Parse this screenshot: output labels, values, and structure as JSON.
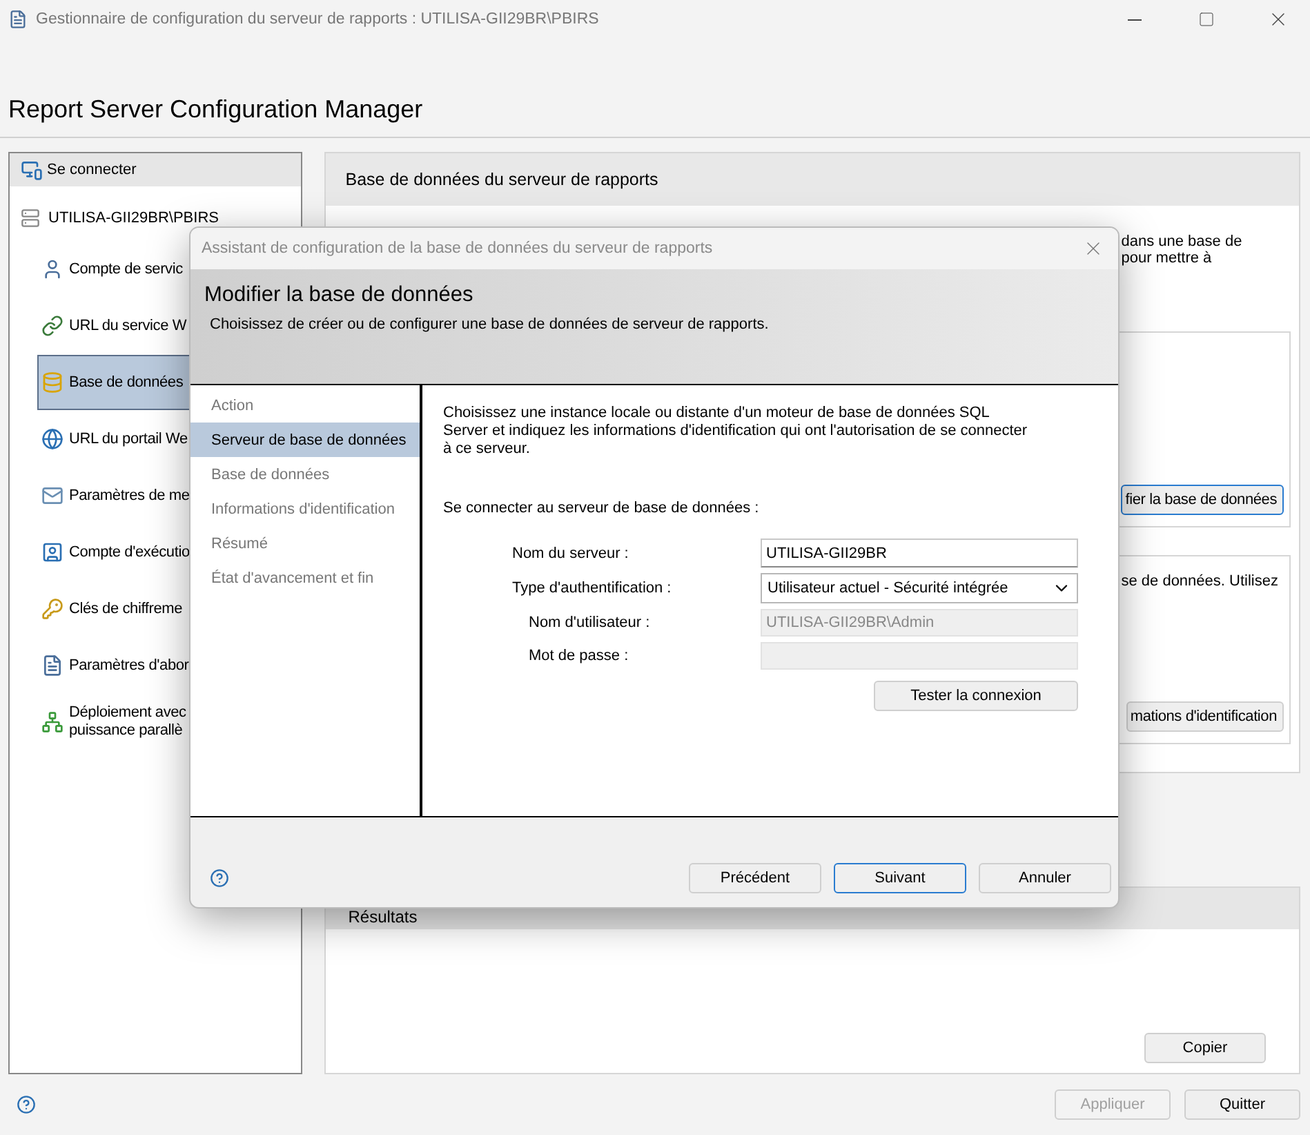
{
  "window": {
    "title": "Gestionnaire de configuration du serveur de rapports : UTILISA-GII29BR\\PBIRS"
  },
  "app_title": "Report Server Configuration Manager",
  "sidebar": {
    "connect": "Se connecter",
    "server": "UTILISA-GII29BR\\PBIRS",
    "items": [
      {
        "lines": [
          "Compte de servic"
        ],
        "selected": false
      },
      {
        "lines": [
          "URL du service W"
        ],
        "selected": false
      },
      {
        "lines": [
          "Base de données"
        ],
        "selected": true
      },
      {
        "lines": [
          "URL du portail We"
        ],
        "selected": false
      },
      {
        "lines": [
          "Paramètres de me"
        ],
        "selected": false
      },
      {
        "lines": [
          "Compte d'exécutio"
        ],
        "selected": false
      },
      {
        "lines": [
          "Clés de chiffreme"
        ],
        "selected": false
      },
      {
        "lines": [
          "Paramètres d'abor"
        ],
        "selected": false
      },
      {
        "lines": [
          "Déploiement avec",
          "puissance parallè"
        ],
        "selected": false
      }
    ]
  },
  "main_panel": {
    "title": "Base de données du serveur de rapports",
    "intro": [
      "dans une base de",
      "pour mettre à"
    ],
    "groups": [
      {
        "button": "fier la base de données",
        "focused": true
      },
      {
        "text": "se de données. Utilisez",
        "button": "mations d'identification",
        "focused": false
      }
    ],
    "results": {
      "title": "Résultats",
      "button": "Copier"
    }
  },
  "footer_buttons": [
    {
      "label": "Appliquer",
      "disabled": true
    },
    {
      "label": "Quitter",
      "disabled": false
    }
  ],
  "dialog": {
    "title": "Assistant de configuration de la base de données du serveur de rapports",
    "heading": "Modifier la base de données",
    "subtitle": "Choisissez de créer ou de configurer une base de données de serveur de rapports.",
    "steps": [
      {
        "label": "Action",
        "selected": false
      },
      {
        "label": "Serveur de base de données",
        "selected": true
      },
      {
        "label": "Base de données",
        "selected": false
      },
      {
        "label": "Informations d'identification",
        "selected": false
      },
      {
        "label": "Résumé",
        "selected": false
      },
      {
        "label": "État d'avancement et fin",
        "selected": false
      }
    ],
    "intro": "Choisissez une instance locale ou distante d'un moteur de base de données SQL Server et indiquez les informations d'identification qui ont l'autorisation de se connecter à ce serveur.",
    "connect_label": "Se connecter au serveur de base de données :",
    "fields": [
      {
        "kind": "text",
        "label": "Nom du serveur :",
        "value": "UTILISA-GII29BR",
        "disabled": false,
        "indent": false
      },
      {
        "kind": "select",
        "label": "Type d'authentification :",
        "value": "Utilisateur actuel - Sécurité intégrée",
        "disabled": false,
        "indent": false
      },
      {
        "kind": "text",
        "label": "Nom d'utilisateur :",
        "value": "UTILISA-GII29BR\\Admin",
        "disabled": true,
        "indent": true
      },
      {
        "kind": "password",
        "label": "Mot de passe :",
        "disabled": true,
        "indent": true
      }
    ],
    "test_button": "Tester la connexion",
    "buttons": [
      {
        "label": "Précédent",
        "default": false
      },
      {
        "label": "Suivant",
        "default": true
      },
      {
        "label": "Annuler",
        "default": false
      }
    ]
  }
}
